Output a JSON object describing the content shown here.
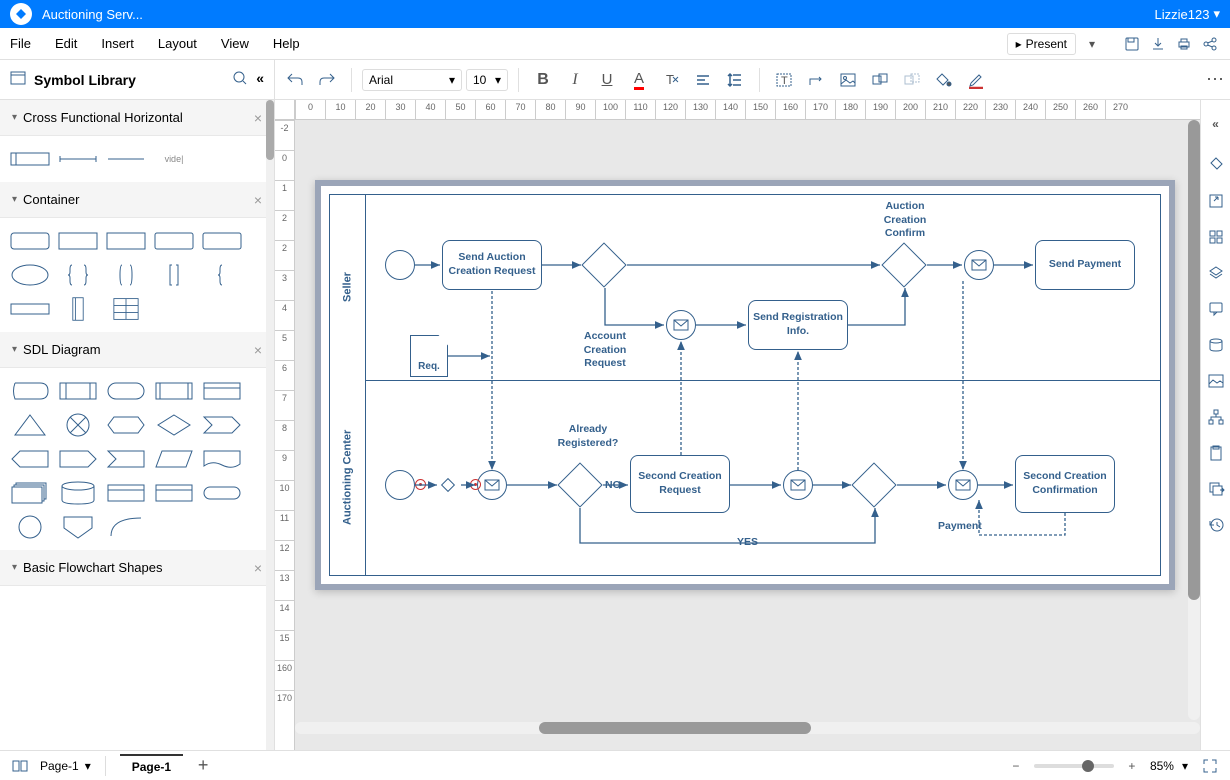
{
  "titlebar": {
    "title": "Auctioning Serv...",
    "user": "Lizzie123"
  },
  "menubar": {
    "items": [
      "File",
      "Edit",
      "Insert",
      "Layout",
      "View",
      "Help"
    ],
    "present": "Present"
  },
  "toolbar": {
    "font": "Arial",
    "size": "10"
  },
  "sidebar": {
    "title": "Symbol Library",
    "categories": [
      "Cross Functional Horizontal",
      "Container",
      "SDL Diagram",
      "Basic Flowchart Shapes"
    ]
  },
  "diagram": {
    "lanes": [
      "Seller",
      "Auctioning Center"
    ],
    "nodes": {
      "task1": "Send Auction Creation Request",
      "task2": "Send Registration Info.",
      "task3": "Send Payment",
      "task4": "Second Creation Request",
      "task5": "Second Creation Confirmation",
      "req": "Req.",
      "label1": "Auction Creation Confirm",
      "label2": "Account Creation Request",
      "label3": "Already Registered?",
      "label4": "NO",
      "label5": "YES",
      "label6": "Payment"
    }
  },
  "statusbar": {
    "page_dropdown": "Page-1",
    "page_tab": "Page-1",
    "zoom": "85%"
  },
  "hruler": [
    "0",
    "10",
    "20",
    "30",
    "40",
    "50",
    "60",
    "70",
    "80",
    "90",
    "100",
    "110",
    "120",
    "130",
    "140",
    "150",
    "160",
    "170",
    "180",
    "190",
    "200",
    "210",
    "220",
    "230",
    "240",
    "250",
    "260",
    "270"
  ],
  "vruler": [
    "-2",
    "0",
    "1",
    "2",
    "2",
    "3",
    "4",
    "5",
    "6",
    "7",
    "8",
    "9",
    "10",
    "11",
    "12",
    "13",
    "14",
    "15",
    "160",
    "170"
  ]
}
